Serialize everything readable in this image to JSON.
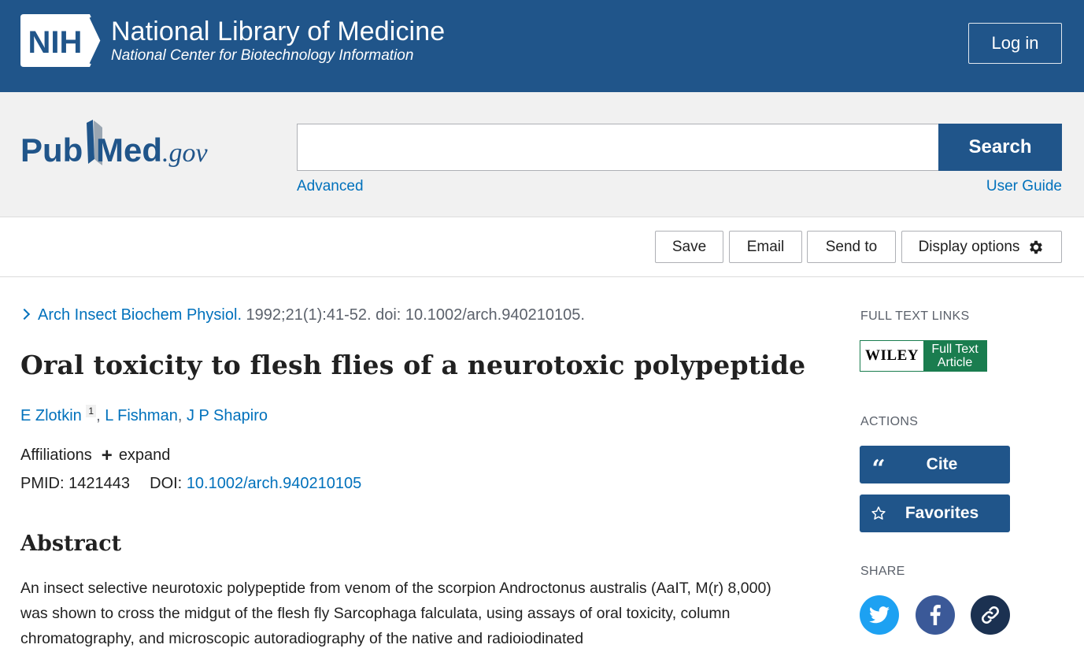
{
  "nih": {
    "logo_text": "NIH",
    "title": "National Library of Medicine",
    "subtitle": "National Center for Biotechnology Information",
    "login_label": "Log in"
  },
  "search": {
    "logo_text_pub": "Pub",
    "logo_text_med": "Med",
    "logo_text_gov": ".gov",
    "input_value": "",
    "placeholder": "",
    "button_label": "Search",
    "advanced_label": "Advanced",
    "guide_label": "User Guide"
  },
  "toolbar": {
    "save_label": "Save",
    "email_label": "Email",
    "send_label": "Send to",
    "display_label": "Display options"
  },
  "article": {
    "journal": "Arch Insect Biochem Physiol.",
    "citation": " 1992;21(1):41-52. doi: 10.1002/arch.940210105.",
    "title": "Oral toxicity to flesh flies of a neurotoxic polypeptide",
    "authors": [
      {
        "name": "E Zlotkin",
        "sup": "1"
      },
      {
        "name": "L Fishman"
      },
      {
        "name": "J P Shapiro"
      }
    ],
    "affiliations_label": "Affiliations",
    "expand_label": "expand",
    "pmid_label": "PMID:",
    "pmid": "1421443",
    "doi_label": "DOI:",
    "doi": "10.1002/arch.940210105",
    "abstract_heading": "Abstract",
    "abstract_text": "An insect selective neurotoxic polypeptide from venom of the scorpion Androctonus australis (AaIT, M(r) 8,000) was shown to cross the midgut of the flesh fly Sarcophaga falculata, using assays of oral toxicity, column chromatography, and microscopic autoradiography of the native and radioiodinated"
  },
  "sidebar": {
    "full_text_label": "FULL TEXT LINKS",
    "wiley_name": "WILEY",
    "wiley_ft_line1": "Full Text",
    "wiley_ft_line2": "Article",
    "actions_label": "ACTIONS",
    "cite_label": "Cite",
    "favorites_label": "Favorites",
    "share_label": "SHARE"
  },
  "colors": {
    "nih_blue": "#20558a",
    "link_blue": "#0071bc",
    "twitter": "#1da1f2",
    "facebook": "#3b5998",
    "wiley_green": "#1a7d4f"
  }
}
